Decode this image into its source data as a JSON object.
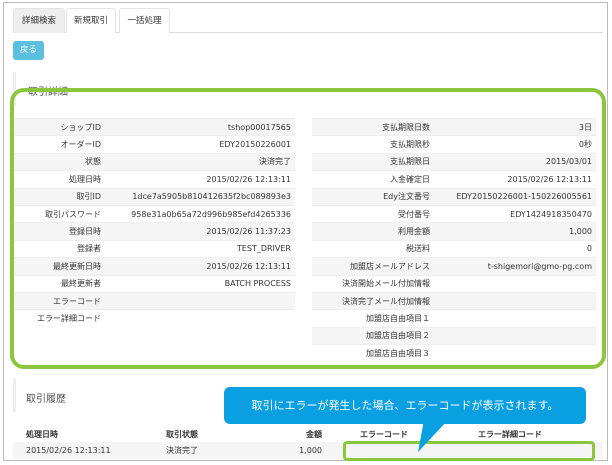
{
  "tabs": [
    {
      "label": "詳細検索",
      "active": true
    },
    {
      "label": "新規取引",
      "active": false
    },
    {
      "label": "一括処理",
      "active": false
    }
  ],
  "back_button": "戻る",
  "detail": {
    "title": "取引詳細",
    "left": [
      {
        "label": "ショップID",
        "value": "tshop00017565"
      },
      {
        "label": "オーダーID",
        "value": "EDY20150226001"
      },
      {
        "label": "状態",
        "value": "決済完了"
      },
      {
        "label": "処理日時",
        "value": "2015/02/26 12:13:11"
      },
      {
        "label": "取引ID",
        "value": "1dce7a5905b810412635f2bc089893e3"
      },
      {
        "label": "取引パスワード",
        "value": "958e31a0b65a72d996b985efd4265336"
      },
      {
        "label": "登録日時",
        "value": "2015/02/26 11:37:23"
      },
      {
        "label": "登録者",
        "value": "TEST_DRIVER"
      },
      {
        "label": "最終更新日時",
        "value": "2015/02/26 12:13:11"
      },
      {
        "label": "最終更新者",
        "value": "BATCH PROCESS"
      },
      {
        "label": "エラーコード",
        "value": ""
      },
      {
        "label": "エラー詳細コード",
        "value": ""
      }
    ],
    "right": [
      {
        "label": "支払期限日数",
        "value": "3日"
      },
      {
        "label": "支払期限秒",
        "value": "0秒"
      },
      {
        "label": "支払期限日",
        "value": "2015/03/01"
      },
      {
        "label": "入金確定日",
        "value": "2015/02/26 12:13:11"
      },
      {
        "label": "Edy注文番号",
        "value": "EDY20150226001-150226005561"
      },
      {
        "label": "受付番号",
        "value": "EDY1424918350470"
      },
      {
        "label": "利用金額",
        "value": "1,000"
      },
      {
        "label": "税送料",
        "value": "0"
      },
      {
        "label": "加盟店メールアドレス",
        "value": "t-shigemori@gmo-pg.com"
      },
      {
        "label": "決済開始メール付加情報",
        "value": ""
      },
      {
        "label": "決済完了メール付加情報",
        "value": ""
      },
      {
        "label": "加盟店自由項目１",
        "value": ""
      },
      {
        "label": "加盟店自由項目２",
        "value": ""
      },
      {
        "label": "加盟店自由項目３",
        "value": ""
      }
    ]
  },
  "history": {
    "title": "取引履歴",
    "headers": [
      "処理日時",
      "取引状態",
      "金額",
      "エラーコード",
      "エラー詳細コード"
    ],
    "rows": [
      [
        "2015/02/26 12:13:11",
        "決済完了",
        "1,000",
        "",
        ""
      ]
    ]
  },
  "callout": {
    "text": "取引にエラーが発生した場合、エラーコードが表示されます。",
    "color": "#0a9fe0"
  },
  "highlight_color": "#8cc63f"
}
